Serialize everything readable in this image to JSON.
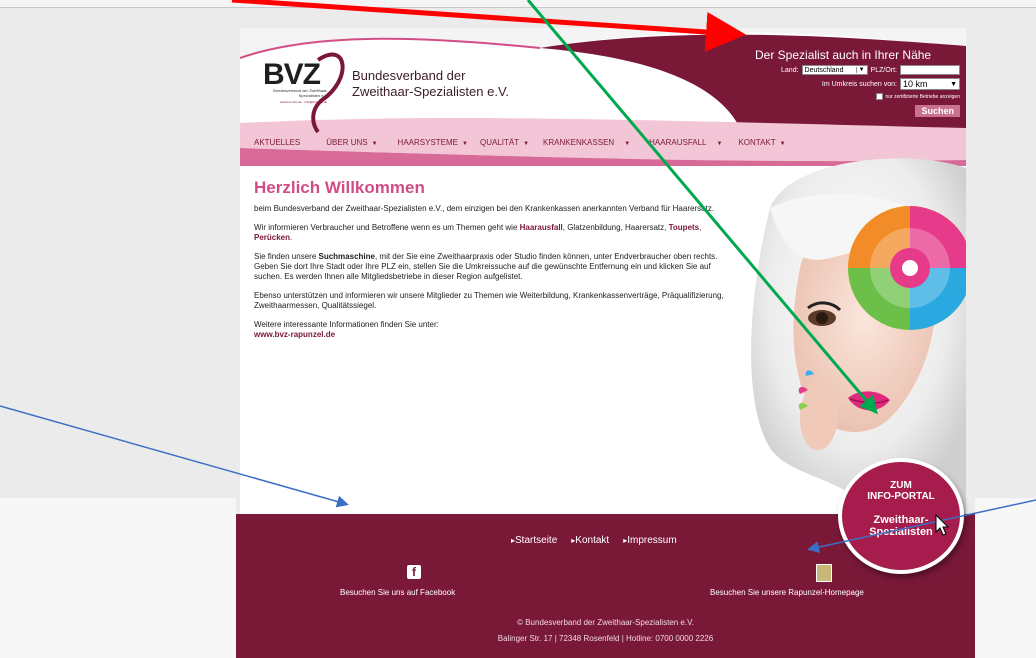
{
  "header": {
    "logo_text": "BVZ",
    "logo_sub": "Bundesverband der Zweithaar-Spezialisten e.V.",
    "logo_url": "www.bvz-info.de · info@bvz-info.de",
    "org_name_line1": "Bundesverband der",
    "org_name_line2": "Zweithaar-Spezialisten e.V."
  },
  "search": {
    "title": "Der Spezialist auch in Ihrer Nähe",
    "land_label": "Land:",
    "land_value": "Deutschland",
    "plz_label": "PLZ/Ort:",
    "plz_value": "",
    "radius_label": "Im Umkreis suchen von:",
    "radius_value": "10 km",
    "certified_label": "nur zertifizierte Betriebe anzeigen",
    "button": "Suchen"
  },
  "nav": [
    {
      "label": "AKTUELLES",
      "caret": false
    },
    {
      "label": "ÜBER UNS",
      "caret": true
    },
    {
      "label": "HAARSYSTEME",
      "caret": true
    },
    {
      "label": "QUALITÄT",
      "caret": true
    },
    {
      "label": "KRANKENKASSEN",
      "caret": true
    },
    {
      "label": "HAARAUSFALL",
      "caret": true
    },
    {
      "label": "KONTAKT",
      "caret": true
    }
  ],
  "content": {
    "heading": "Herzlich Willkommen",
    "p1": "beim Bundesverband der Zweithaar-Spezialisten e.V., dem einzigen bei den Krankenkassen anerkannten Verband für Haarersatz.",
    "p2_a": "Wir informieren Verbraucher und Betroffene wenn es um Themen geht wie ",
    "p2_b": "Haarausfall",
    "p2_c": ", Glatzenbildung, Haarersatz, ",
    "p2_d": "Toupets",
    "p2_e": ", ",
    "p2_f": "Perücken",
    "p2_g": ".",
    "p3_a": "Sie finden unsere ",
    "p3_b": "Suchmaschine",
    "p3_c": ", mit der Sie eine Zweithaarpraxis oder Studio finden können, unter Endverbraucher oben rechts. Geben Sie dort Ihre Stadt oder Ihre PLZ ein, stellen Sie die Umkreissuche auf die gewünschte Entfernung ein und klicken Sie auf suchen. Es werden Ihnen alle Mitgliedsbetriebe in dieser Region aufgelistet.",
    "p4": "Ebenso unterstützen und informieren wir unsere Mitglieder zu Themen wie Weiterbildung, Krankenkassenverträge, Präqualifizierung, Zweithaarmessen, Qualitätssiegel.",
    "p5": "Weitere interessante Informationen finden Sie unter:",
    "link": "www.bvz-rapunzel.de"
  },
  "footer": {
    "links": [
      "Startseite",
      "Kontakt",
      "Impressum"
    ],
    "facebook_text": "Besuchen Sie uns auf Facebook",
    "rapunzel_text": "Besuchen Sie unsere Rapunzel-Homepage",
    "copyright": "© Bundesverband der Zweithaar-Spezialisten e.V.",
    "address": "Balinger Str. 17  |  72348 Rosenfeld  |  Hotline: 0700 0000 2226"
  },
  "portal_badge": {
    "line1": "ZUM",
    "line2": "INFO-PORTAL",
    "line3": "Zweithaar-",
    "line4": "Spezialisten"
  },
  "colors": {
    "brand": "#7a1838",
    "accent_pink": "#d14d86",
    "annotation_red": "#ff0000",
    "annotation_green": "#00a84f",
    "annotation_blue": "#3b6fc4"
  }
}
